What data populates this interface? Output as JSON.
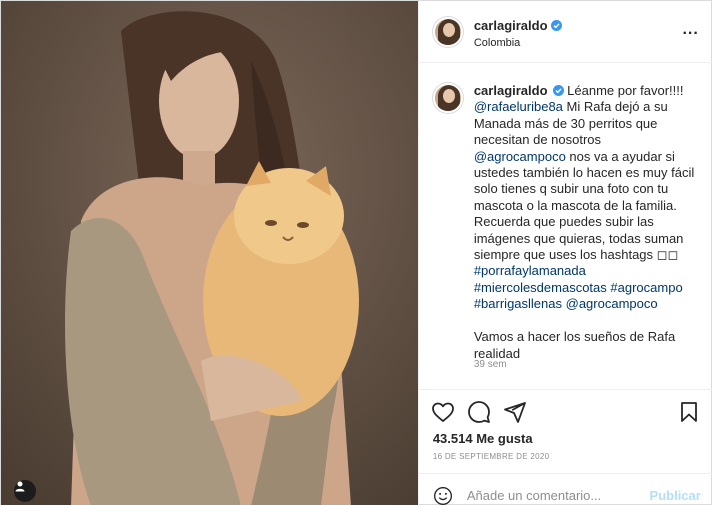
{
  "header": {
    "username": "carlagiraldo",
    "location": "Colombia",
    "more_label": "..."
  },
  "caption": {
    "username": "carlagiraldo",
    "segments": [
      {
        "text": " Léanme por favor!!!!\n",
        "link": false
      },
      {
        "text": "@rafaeluribe8a",
        "link": true
      },
      {
        "text": " Mi Rafa dejó a su Manada más de 30 perritos que necesitan de nosotros\n",
        "link": false
      },
      {
        "text": "@agrocampoco",
        "link": true
      },
      {
        "text": " nos va a ayudar si ustedes también lo hacen es muy fácil solo tienes q subir una foto con tu mascota o la mascota de la familia. Recuerda que puedes subir las imágenes que quieras, todas suman siempre que uses los hashtags ◻◻\n",
        "link": false
      },
      {
        "text": "#porrafaylamanada",
        "link": true
      },
      {
        "text": "\n",
        "link": false
      },
      {
        "text": "#miercolesdemascotas",
        "link": true
      },
      {
        "text": " ",
        "link": false
      },
      {
        "text": "#agrocampo",
        "link": true
      },
      {
        "text": "\n",
        "link": false
      },
      {
        "text": "#barrigasllenas",
        "link": true
      },
      {
        "text": " ",
        "link": false
      },
      {
        "text": "@agrocampoco",
        "link": true
      },
      {
        "text": "\n\nVamos a hacer los sueños de Rafa realidad",
        "link": false
      }
    ],
    "time": "39 sem"
  },
  "stats": {
    "likes": "43.514 Me gusta",
    "date": "16 DE SEPTIEMBRE DE 2020"
  },
  "comment": {
    "placeholder": "Añade un comentario...",
    "post_label": "Publicar"
  },
  "icons": {
    "like": "heart-icon",
    "comment": "comment-icon",
    "share": "paper-plane-icon",
    "save": "bookmark-icon",
    "emoji": "smiley-icon",
    "verified": "verified-badge-icon",
    "user_tag": "user-tag-icon"
  },
  "colors": {
    "verified": "#3897f0",
    "link": "#00376b",
    "muted": "#8e8e8e",
    "post_disabled": "#b2dffc",
    "border": "#dbdbdb"
  }
}
